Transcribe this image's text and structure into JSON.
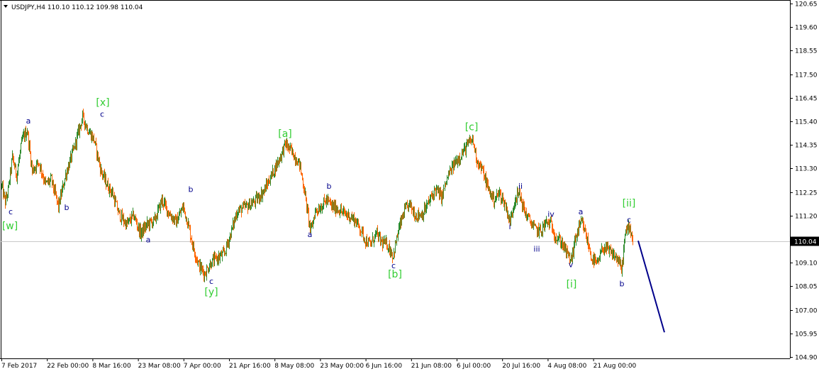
{
  "window": {
    "header": "USDJPY,H4  110.10 110.12 109.98 110.04",
    "menu_icon": "triangle-down-icon"
  },
  "chart_data": {
    "type": "candlestick",
    "title": "USDJPY,H4",
    "symbol": "USDJPY",
    "timeframe": "H4",
    "ohlc_last": {
      "open": 110.1,
      "high": 110.12,
      "low": 109.98,
      "close": 110.04
    },
    "current_price": 110.04,
    "current_price_label": "110.04",
    "ylim": [
      104.9,
      120.65
    ],
    "y_ticks": [
      "120.65",
      "119.60",
      "118.55",
      "117.50",
      "116.45",
      "115.40",
      "114.35",
      "113.30",
      "112.25",
      "111.20",
      "110.04",
      "109.10",
      "108.05",
      "107.00",
      "105.95",
      "104.90"
    ],
    "x_ticks": [
      "7 Feb 2017",
      "22 Feb 00:00",
      "8 Mar 16:00",
      "23 Mar 08:00",
      "7 Apr 00:00",
      "21 Apr 16:00",
      "8 May 08:00",
      "23 May 00:00",
      "6 Jun 16:00",
      "21 Jun 08:00",
      "6 Jul 00:00",
      "20 Jul 16:00",
      "4 Aug 08:00",
      "21 Aug 00:00"
    ],
    "up_color": "#2e8b2e",
    "down_color": "#ff6600",
    "grid": false,
    "price_path": [
      {
        "i": 0,
        "p": 112.5
      },
      {
        "i": 5,
        "p": 111.8
      },
      {
        "i": 9,
        "p": 112.3
      },
      {
        "i": 15,
        "p": 113.8
      },
      {
        "i": 21,
        "p": 113.0
      },
      {
        "i": 29,
        "p": 114.6
      },
      {
        "i": 36,
        "p": 115.0
      },
      {
        "i": 43,
        "p": 113.2
      },
      {
        "i": 52,
        "p": 113.6
      },
      {
        "i": 62,
        "p": 112.6
      },
      {
        "i": 70,
        "p": 112.8
      },
      {
        "i": 80,
        "p": 111.6
      },
      {
        "i": 90,
        "p": 113.0
      },
      {
        "i": 102,
        "p": 114.2
      },
      {
        "i": 114,
        "p": 115.6
      },
      {
        "i": 122,
        "p": 115.0
      },
      {
        "i": 130,
        "p": 114.6
      },
      {
        "i": 140,
        "p": 113.2
      },
      {
        "i": 148,
        "p": 112.6
      },
      {
        "i": 156,
        "p": 112.2
      },
      {
        "i": 165,
        "p": 111.3
      },
      {
        "i": 176,
        "p": 110.8
      },
      {
        "i": 186,
        "p": 111.2
      },
      {
        "i": 196,
        "p": 110.4
      },
      {
        "i": 205,
        "p": 110.8
      },
      {
        "i": 216,
        "p": 111.0
      },
      {
        "i": 226,
        "p": 111.9
      },
      {
        "i": 236,
        "p": 111.3
      },
      {
        "i": 246,
        "p": 110.9
      },
      {
        "i": 256,
        "p": 111.6
      },
      {
        "i": 263,
        "p": 110.8
      },
      {
        "i": 270,
        "p": 109.8
      },
      {
        "i": 278,
        "p": 109.0
      },
      {
        "i": 286,
        "p": 108.6
      },
      {
        "i": 295,
        "p": 109.1
      },
      {
        "i": 304,
        "p": 109.3
      },
      {
        "i": 314,
        "p": 109.5
      },
      {
        "i": 322,
        "p": 110.3
      },
      {
        "i": 332,
        "p": 111.4
      },
      {
        "i": 345,
        "p": 111.6
      },
      {
        "i": 356,
        "p": 111.8
      },
      {
        "i": 370,
        "p": 112.3
      },
      {
        "i": 382,
        "p": 113.1
      },
      {
        "i": 394,
        "p": 113.9
      },
      {
        "i": 400,
        "p": 114.4
      },
      {
        "i": 410,
        "p": 114.0
      },
      {
        "i": 420,
        "p": 113.5
      },
      {
        "i": 427,
        "p": 112.3
      },
      {
        "i": 432,
        "p": 111.2
      },
      {
        "i": 436,
        "p": 110.5
      },
      {
        "i": 442,
        "p": 111.4
      },
      {
        "i": 450,
        "p": 111.6
      },
      {
        "i": 458,
        "p": 111.9
      },
      {
        "i": 466,
        "p": 111.6
      },
      {
        "i": 474,
        "p": 111.5
      },
      {
        "i": 482,
        "p": 111.3
      },
      {
        "i": 490,
        "p": 111.2
      },
      {
        "i": 498,
        "p": 111.0
      },
      {
        "i": 506,
        "p": 110.6
      },
      {
        "i": 513,
        "p": 110.1
      },
      {
        "i": 520,
        "p": 109.9
      },
      {
        "i": 528,
        "p": 110.4
      },
      {
        "i": 536,
        "p": 110.0
      },
      {
        "i": 544,
        "p": 109.9
      },
      {
        "i": 552,
        "p": 109.4
      },
      {
        "i": 560,
        "p": 110.6
      },
      {
        "i": 568,
        "p": 111.4
      },
      {
        "i": 575,
        "p": 111.7
      },
      {
        "i": 584,
        "p": 111.2
      },
      {
        "i": 594,
        "p": 111.3
      },
      {
        "i": 604,
        "p": 111.9
      },
      {
        "i": 612,
        "p": 112.4
      },
      {
        "i": 620,
        "p": 112.0
      },
      {
        "i": 630,
        "p": 113.0
      },
      {
        "i": 640,
        "p": 113.6
      },
      {
        "i": 650,
        "p": 114.0
      },
      {
        "i": 658,
        "p": 114.4
      },
      {
        "i": 664,
        "p": 114.6
      },
      {
        "i": 670,
        "p": 113.7
      },
      {
        "i": 678,
        "p": 113.2
      },
      {
        "i": 686,
        "p": 112.4
      },
      {
        "i": 694,
        "p": 111.9
      },
      {
        "i": 702,
        "p": 112.2
      },
      {
        "i": 710,
        "p": 111.7
      },
      {
        "i": 717,
        "p": 110.9
      },
      {
        "i": 724,
        "p": 112.0
      },
      {
        "i": 730,
        "p": 112.2
      },
      {
        "i": 737,
        "p": 111.4
      },
      {
        "i": 744,
        "p": 111.0
      },
      {
        "i": 752,
        "p": 110.6
      },
      {
        "i": 760,
        "p": 110.5
      },
      {
        "i": 768,
        "p": 110.9
      },
      {
        "i": 775,
        "p": 110.8
      },
      {
        "i": 782,
        "p": 110.2
      },
      {
        "i": 790,
        "p": 110.0
      },
      {
        "i": 797,
        "p": 109.5
      },
      {
        "i": 803,
        "p": 109.2
      },
      {
        "i": 810,
        "p": 110.3
      },
      {
        "i": 818,
        "p": 110.9
      },
      {
        "i": 824,
        "p": 110.3
      },
      {
        "i": 832,
        "p": 109.3
      },
      {
        "i": 840,
        "p": 109.0
      },
      {
        "i": 848,
        "p": 109.8
      },
      {
        "i": 856,
        "p": 109.6
      },
      {
        "i": 864,
        "p": 109.4
      },
      {
        "i": 870,
        "p": 109.2
      },
      {
        "i": 874,
        "p": 108.7
      },
      {
        "i": 879,
        "p": 110.3
      },
      {
        "i": 885,
        "p": 110.8
      },
      {
        "i": 890,
        "p": 110.1
      }
    ],
    "forecast_line": {
      "color": "#00008b",
      "from": {
        "i": 898,
        "p": 110.08
      },
      "to": {
        "i": 935,
        "p": 106.0
      }
    },
    "wave_labels": [
      {
        "text": "a",
        "i": 38,
        "p": 115.3,
        "color": "#00008b"
      },
      {
        "text": "c",
        "i": 13,
        "p": 111.25,
        "color": "#00008b"
      },
      {
        "text": "[w]",
        "i": 12,
        "p": 110.6,
        "color": "#32cd32"
      },
      {
        "text": "b",
        "i": 92,
        "p": 111.45,
        "color": "#00008b"
      },
      {
        "text": "[x]",
        "i": 143,
        "p": 116.1,
        "color": "#32cd32"
      },
      {
        "text": "c",
        "i": 142,
        "p": 115.6,
        "color": "#00008b"
      },
      {
        "text": "a",
        "i": 207,
        "p": 110.0,
        "color": "#00008b"
      },
      {
        "text": "b",
        "i": 267,
        "p": 112.25,
        "color": "#00008b"
      },
      {
        "text": "c",
        "i": 296,
        "p": 108.15,
        "color": "#00008b"
      },
      {
        "text": "[y]",
        "i": 296,
        "p": 107.65,
        "color": "#32cd32"
      },
      {
        "text": "[a]",
        "i": 400,
        "p": 114.7,
        "color": "#32cd32"
      },
      {
        "text": "b",
        "i": 462,
        "p": 112.4,
        "color": "#00008b"
      },
      {
        "text": "a",
        "i": 435,
        "p": 110.25,
        "color": "#00008b"
      },
      {
        "text": "c",
        "i": 553,
        "p": 108.85,
        "color": "#00008b"
      },
      {
        "text": "[b]",
        "i": 555,
        "p": 108.45,
        "color": "#32cd32"
      },
      {
        "text": "[c]",
        "i": 663,
        "p": 115.0,
        "color": "#32cd32"
      },
      {
        "text": "ii",
        "i": 732,
        "p": 112.4,
        "color": "#00008b"
      },
      {
        "text": "i",
        "i": 717,
        "p": 110.6,
        "color": "#00008b"
      },
      {
        "text": "iv",
        "i": 775,
        "p": 111.15,
        "color": "#00008b"
      },
      {
        "text": "iii",
        "i": 755,
        "p": 109.6,
        "color": "#00008b"
      },
      {
        "text": "a",
        "i": 817,
        "p": 111.25,
        "color": "#00008b"
      },
      {
        "text": "v",
        "i": 803,
        "p": 108.9,
        "color": "#00008b"
      },
      {
        "text": "[i]",
        "i": 804,
        "p": 108.0,
        "color": "#32cd32"
      },
      {
        "text": "[ii]",
        "i": 885,
        "p": 111.6,
        "color": "#32cd32"
      },
      {
        "text": "c",
        "i": 885,
        "p": 110.9,
        "color": "#00008b"
      },
      {
        "text": "b",
        "i": 875,
        "p": 108.05,
        "color": "#00008b"
      }
    ]
  }
}
